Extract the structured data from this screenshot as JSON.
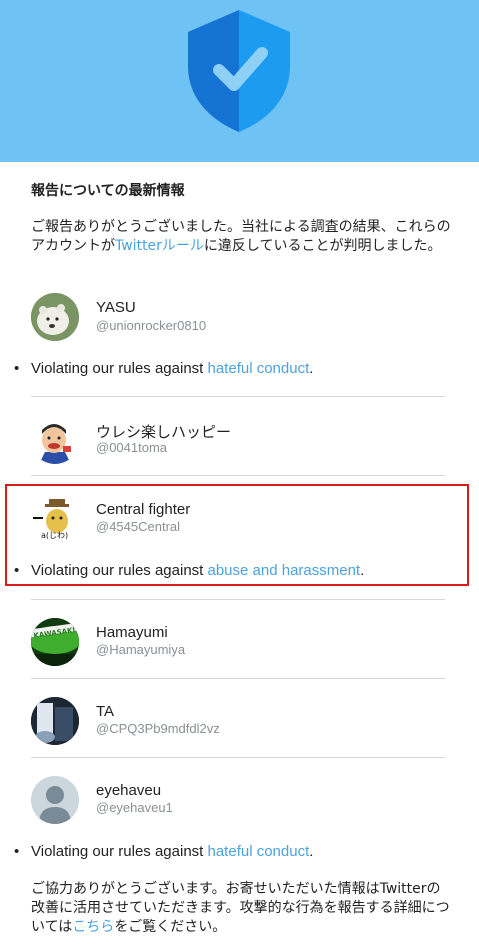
{
  "header": {
    "icon": "shield-check-icon",
    "background": "#6ec2f4"
  },
  "report": {
    "title": "報告についての最新情報",
    "intro_before_link": "ご報告ありがとうございました。当社による調査の結果、これらのアカウントが",
    "intro_link": "Twitterルール",
    "intro_after_link": "に違反していることが判明しました。"
  },
  "violation_prefix": "Violating our rules against ",
  "accounts": [
    {
      "name": "YASU",
      "handle": "@unionrocker0810",
      "violation_link": "hateful conduct",
      "suffix": "."
    },
    {
      "name": "ウレシ楽しハッピー",
      "handle": "@0041toma"
    },
    {
      "name": "Central fighter",
      "handle": "@4545Central",
      "violation_link": "abuse and harassment",
      "suffix": "."
    },
    {
      "name": "Hamayumi",
      "handle": "@Hamayumiya"
    },
    {
      "name": "TA",
      "handle": "@CPQ3Pb9mdfdl2vz"
    },
    {
      "name": "eyehaveu",
      "handle": "@eyehaveu1",
      "violation_link": "hateful conduct",
      "suffix": "."
    }
  ],
  "footer": {
    "text_before_link": "ご協力ありがとうございます。お寄せいただいた情報はTwitterの改善に活用させていただきます。攻撃的な行為を報告する詳細については",
    "link": "こちら",
    "text_after_link": "をご覧ください。"
  },
  "colors": {
    "link": "#4aa3df",
    "highlight_border": "#d91c1c",
    "divider": "#d6d9dc"
  }
}
